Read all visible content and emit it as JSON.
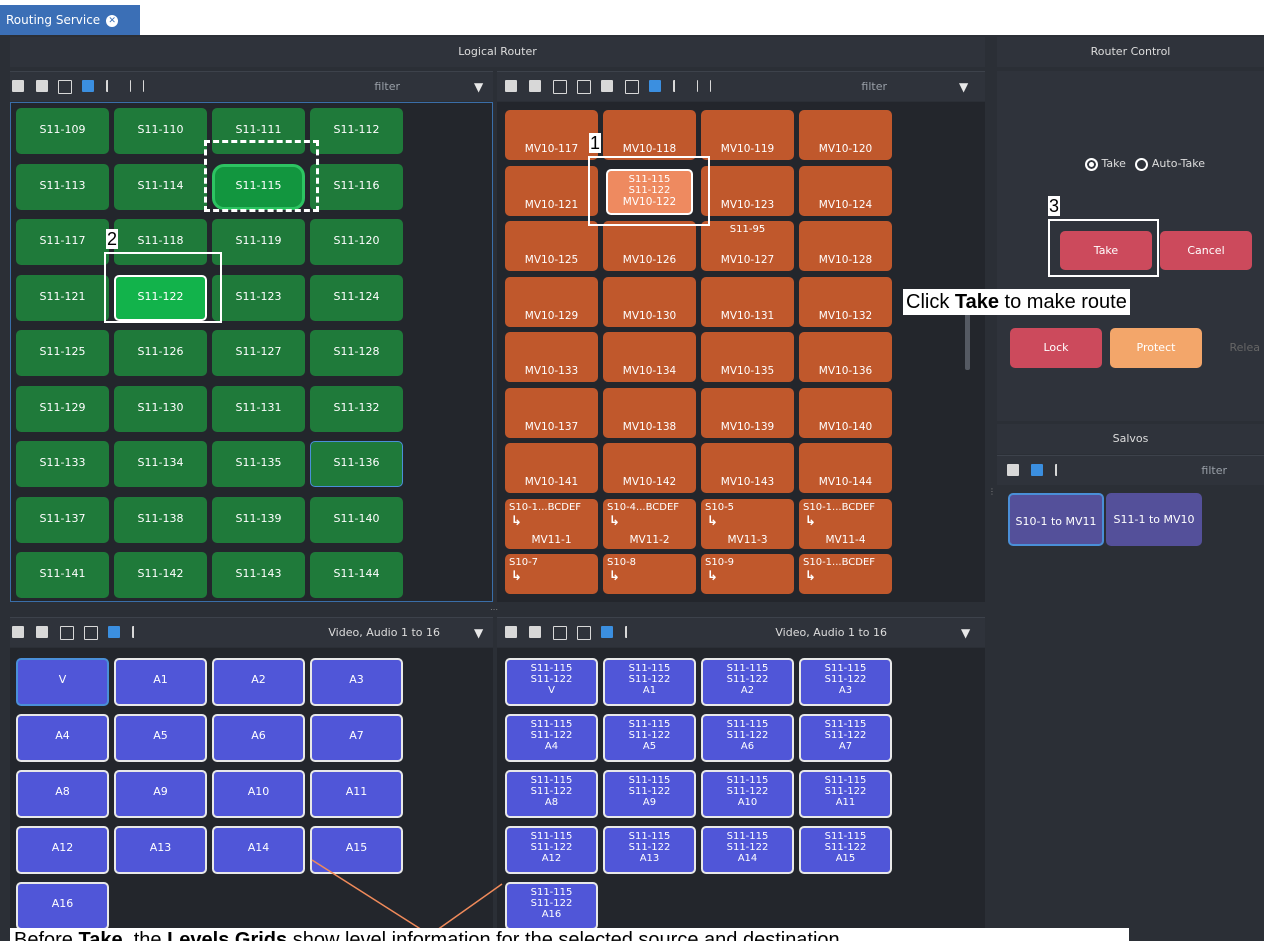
{
  "tab": {
    "title": "Routing Service"
  },
  "logical_router": {
    "title": "Logical Router"
  },
  "router_control": {
    "title": "Router Control",
    "take_mode": "Take",
    "auto_take": "Auto-Take",
    "take_button": "Take",
    "cancel_button": "Cancel",
    "lock_button": "Lock",
    "protect_button": "Protect",
    "release_button": "Relea"
  },
  "salvos": {
    "title": "Salvos",
    "filter_placeholder": "filter",
    "items": [
      "S10-1 to MV11",
      "S11-1 to MV10"
    ]
  },
  "filters": {
    "sources": "filter",
    "destinations": "filter",
    "source_levels": "Video, Audio 1 to 16",
    "dest_levels": "Video, Audio 1 to 16"
  },
  "sources": [
    "S11-109",
    "S11-110",
    "S11-111",
    "S11-112",
    "S11-113",
    "S11-114",
    "S11-115",
    "S11-116",
    "S11-117",
    "S11-118",
    "S11-119",
    "S11-120",
    "S11-121",
    "S11-122",
    "S11-123",
    "S11-124",
    "S11-125",
    "S11-126",
    "S11-127",
    "S11-128",
    "S11-129",
    "S11-130",
    "S11-131",
    "S11-132",
    "S11-133",
    "S11-134",
    "S11-135",
    "S11-136",
    "S11-137",
    "S11-138",
    "S11-139",
    "S11-140",
    "S11-141",
    "S11-142",
    "S11-143",
    "S11-144"
  ],
  "destinations": [
    {
      "top": "",
      "label": "MV10-117"
    },
    {
      "top": "",
      "label": "MV10-118"
    },
    {
      "top": "",
      "label": "MV10-119"
    },
    {
      "top": "",
      "label": "MV10-120"
    },
    {
      "top": "",
      "label": "MV10-121"
    },
    {
      "top": "S11-115\nS11-122",
      "label": "MV10-122"
    },
    {
      "top": "",
      "label": "MV10-123"
    },
    {
      "top": "",
      "label": "MV10-124"
    },
    {
      "top": "",
      "label": "MV10-125"
    },
    {
      "top": "",
      "label": "MV10-126"
    },
    {
      "top": "S11-95",
      "label": "MV10-127"
    },
    {
      "top": "",
      "label": "MV10-128"
    },
    {
      "top": "",
      "label": "MV10-129"
    },
    {
      "top": "",
      "label": "MV10-130"
    },
    {
      "top": "",
      "label": "MV10-131"
    },
    {
      "top": "",
      "label": "MV10-132"
    },
    {
      "top": "",
      "label": "MV10-133"
    },
    {
      "top": "",
      "label": "MV10-134"
    },
    {
      "top": "",
      "label": "MV10-135"
    },
    {
      "top": "",
      "label": "MV10-136"
    },
    {
      "top": "",
      "label": "MV10-137"
    },
    {
      "top": "",
      "label": "MV10-138"
    },
    {
      "top": "",
      "label": "MV10-139"
    },
    {
      "top": "",
      "label": "MV10-140"
    },
    {
      "top": "",
      "label": "MV10-141"
    },
    {
      "top": "",
      "label": "MV10-142"
    },
    {
      "top": "",
      "label": "MV10-143"
    },
    {
      "top": "",
      "label": "MV10-144"
    },
    {
      "top": "S10-1...BCDEF",
      "label": "MV11-1"
    },
    {
      "top": "S10-4...BCDEF",
      "label": "MV11-2"
    },
    {
      "top": "S10-5",
      "label": "MV11-3"
    },
    {
      "top": "S10-1...BCDEF",
      "label": "MV11-4"
    },
    {
      "top": "S10-7",
      "label": ""
    },
    {
      "top": "S10-8",
      "label": ""
    },
    {
      "top": "S10-9",
      "label": ""
    },
    {
      "top": "S10-1...BCDEF",
      "label": ""
    }
  ],
  "source_levels": [
    "V",
    "A1",
    "A2",
    "A3",
    "A4",
    "A5",
    "A6",
    "A7",
    "A8",
    "A9",
    "A10",
    "A11",
    "A12",
    "A13",
    "A14",
    "A15",
    "A16"
  ],
  "dest_levels": [
    "V",
    "A1",
    "A2",
    "A3",
    "A4",
    "A5",
    "A6",
    "A7",
    "A8",
    "A9",
    "A10",
    "A11",
    "A12",
    "A13",
    "A14",
    "A15",
    "A16"
  ],
  "dest_level_sources": "S11-115\nS11-122",
  "annotations": {
    "num1": "1",
    "num2": "2",
    "num3": "3",
    "take_note_pre": "Click ",
    "take_note_bold": "Take",
    "take_note_post": " to make route",
    "bottom_pre": "Before ",
    "bottom_b1": "Take",
    "bottom_mid": ", the ",
    "bottom_b2": "Levels Grids",
    "bottom_post": " show level information for the selected source and destination"
  },
  "colors": {
    "source_green": "#1f7a3a",
    "dest_orange": "#c0582c",
    "level_blue": "#5056d8",
    "take_red": "#cc4a5c",
    "protect_orange": "#f3a66a",
    "salvo_purple": "#54509a"
  }
}
